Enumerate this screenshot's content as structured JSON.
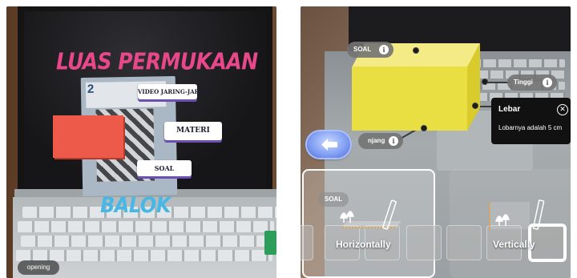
{
  "left_screen": {
    "title": "LUAS PERMUKAAN",
    "book_number": "2",
    "labels": {
      "video": "VIDEO JARING-JARING",
      "materi": "MATERI",
      "soal": "SOAL"
    },
    "shape_name": "BALOK",
    "opening_button": "opening",
    "colors": {
      "title": "#e8488a",
      "shape_name": "#47b8e6",
      "block": "#ee5a49",
      "label_shadow": "#6c4fb0"
    }
  },
  "right_screen": {
    "soal_pill": "SOAL",
    "tinggi_pill": "Tinggi",
    "panjang_pill": "njang",
    "lebar_popup": {
      "title": "Lebar",
      "body": "Lobarnya adalah 5 cm",
      "close_icon": "close-icon"
    },
    "back_button_icon": "back-arrow-icon",
    "soal_badge": "SOAL",
    "placement_modes": [
      {
        "label": "Horizontally",
        "icon": "horizontal-plane-icon",
        "selected": true
      },
      {
        "label": "Vertically",
        "icon": "vertical-plane-icon",
        "selected": false
      }
    ],
    "colors": {
      "block_front": "#eadf42",
      "block_top": "#f4ea86",
      "popup_bg": "#111111",
      "back_button": "#7f9cf2"
    }
  }
}
